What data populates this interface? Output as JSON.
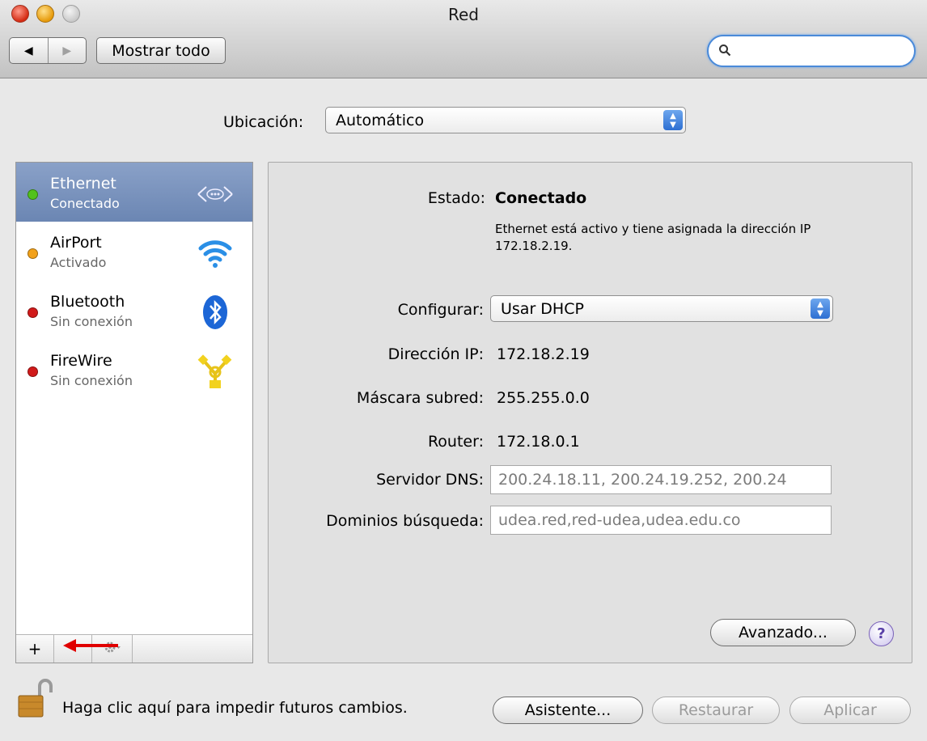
{
  "window": {
    "title": "Red"
  },
  "toolbar": {
    "back_glyph": "◀",
    "forward_glyph": "▶",
    "show_all_label": "Mostrar todo",
    "search_icon": "search-icon",
    "search_value": ""
  },
  "location": {
    "label": "Ubicación:",
    "value": "Automático"
  },
  "services": [
    {
      "name": "Ethernet",
      "status": "Conectado",
      "dot_color": "#52c21c",
      "icon": "ethernet-icon",
      "selected": true
    },
    {
      "name": "AirPort",
      "status": "Activado",
      "dot_color": "#f2a11a",
      "icon": "wifi-icon",
      "selected": false
    },
    {
      "name": "Bluetooth",
      "status": "Sin conexión",
      "dot_color": "#d11a1a",
      "icon": "bluetooth-icon",
      "selected": false
    },
    {
      "name": "FireWire",
      "status": "Sin conexión",
      "dot_color": "#d11a1a",
      "icon": "firewire-icon",
      "selected": false
    }
  ],
  "sidebar_buttons": {
    "add_label": "+",
    "gear_icon": "gear-icon"
  },
  "detail": {
    "status_label": "Estado:",
    "status_value": "Conectado",
    "status_note": "Ethernet está activo y tiene asignada la dirección IP 172.18.2.19.",
    "configure_label": "Configurar:",
    "configure_value": "Usar DHCP",
    "ip_label": "Dirección IP:",
    "ip_value": "172.18.2.19",
    "mask_label": "Máscara subred:",
    "mask_value": "255.255.0.0",
    "router_label": "Router:",
    "router_value": "172.18.0.1",
    "dns_label": "Servidor DNS:",
    "dns_value": "200.24.18.11, 200.24.19.252, 200.24",
    "search_domains_label": "Dominios búsqueda:",
    "search_domains_value": "udea.red,red-udea,udea.edu.co",
    "advanced_label": "Avanzado...",
    "help_label": "?"
  },
  "footer": {
    "lock_text": "Haga clic aquí para impedir futuros cambios.",
    "assistant_label": "Asistente...",
    "revert_label": "Restaurar",
    "apply_label": "Aplicar"
  },
  "colors": {
    "selection": "#7891bd",
    "focus": "#4a8ad9",
    "annotation_arrow": "#e00000"
  }
}
